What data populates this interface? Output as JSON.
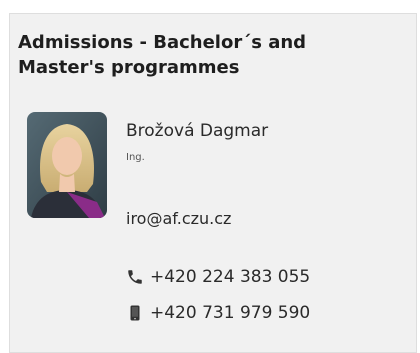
{
  "card": {
    "title": "Admissions - Bachelor´s and Master's programmes"
  },
  "contact": {
    "name": "Brožová Dagmar",
    "degree": "Ing.",
    "email": "iro@af.czu.cz",
    "phones": [
      {
        "icon": "phone-icon",
        "number": "+420 224 383 055"
      },
      {
        "icon": "mobile-icon",
        "number": "+420 731 979 590"
      }
    ]
  },
  "colors": {
    "card_bg": "#f1f1f1",
    "text": "#222222"
  }
}
